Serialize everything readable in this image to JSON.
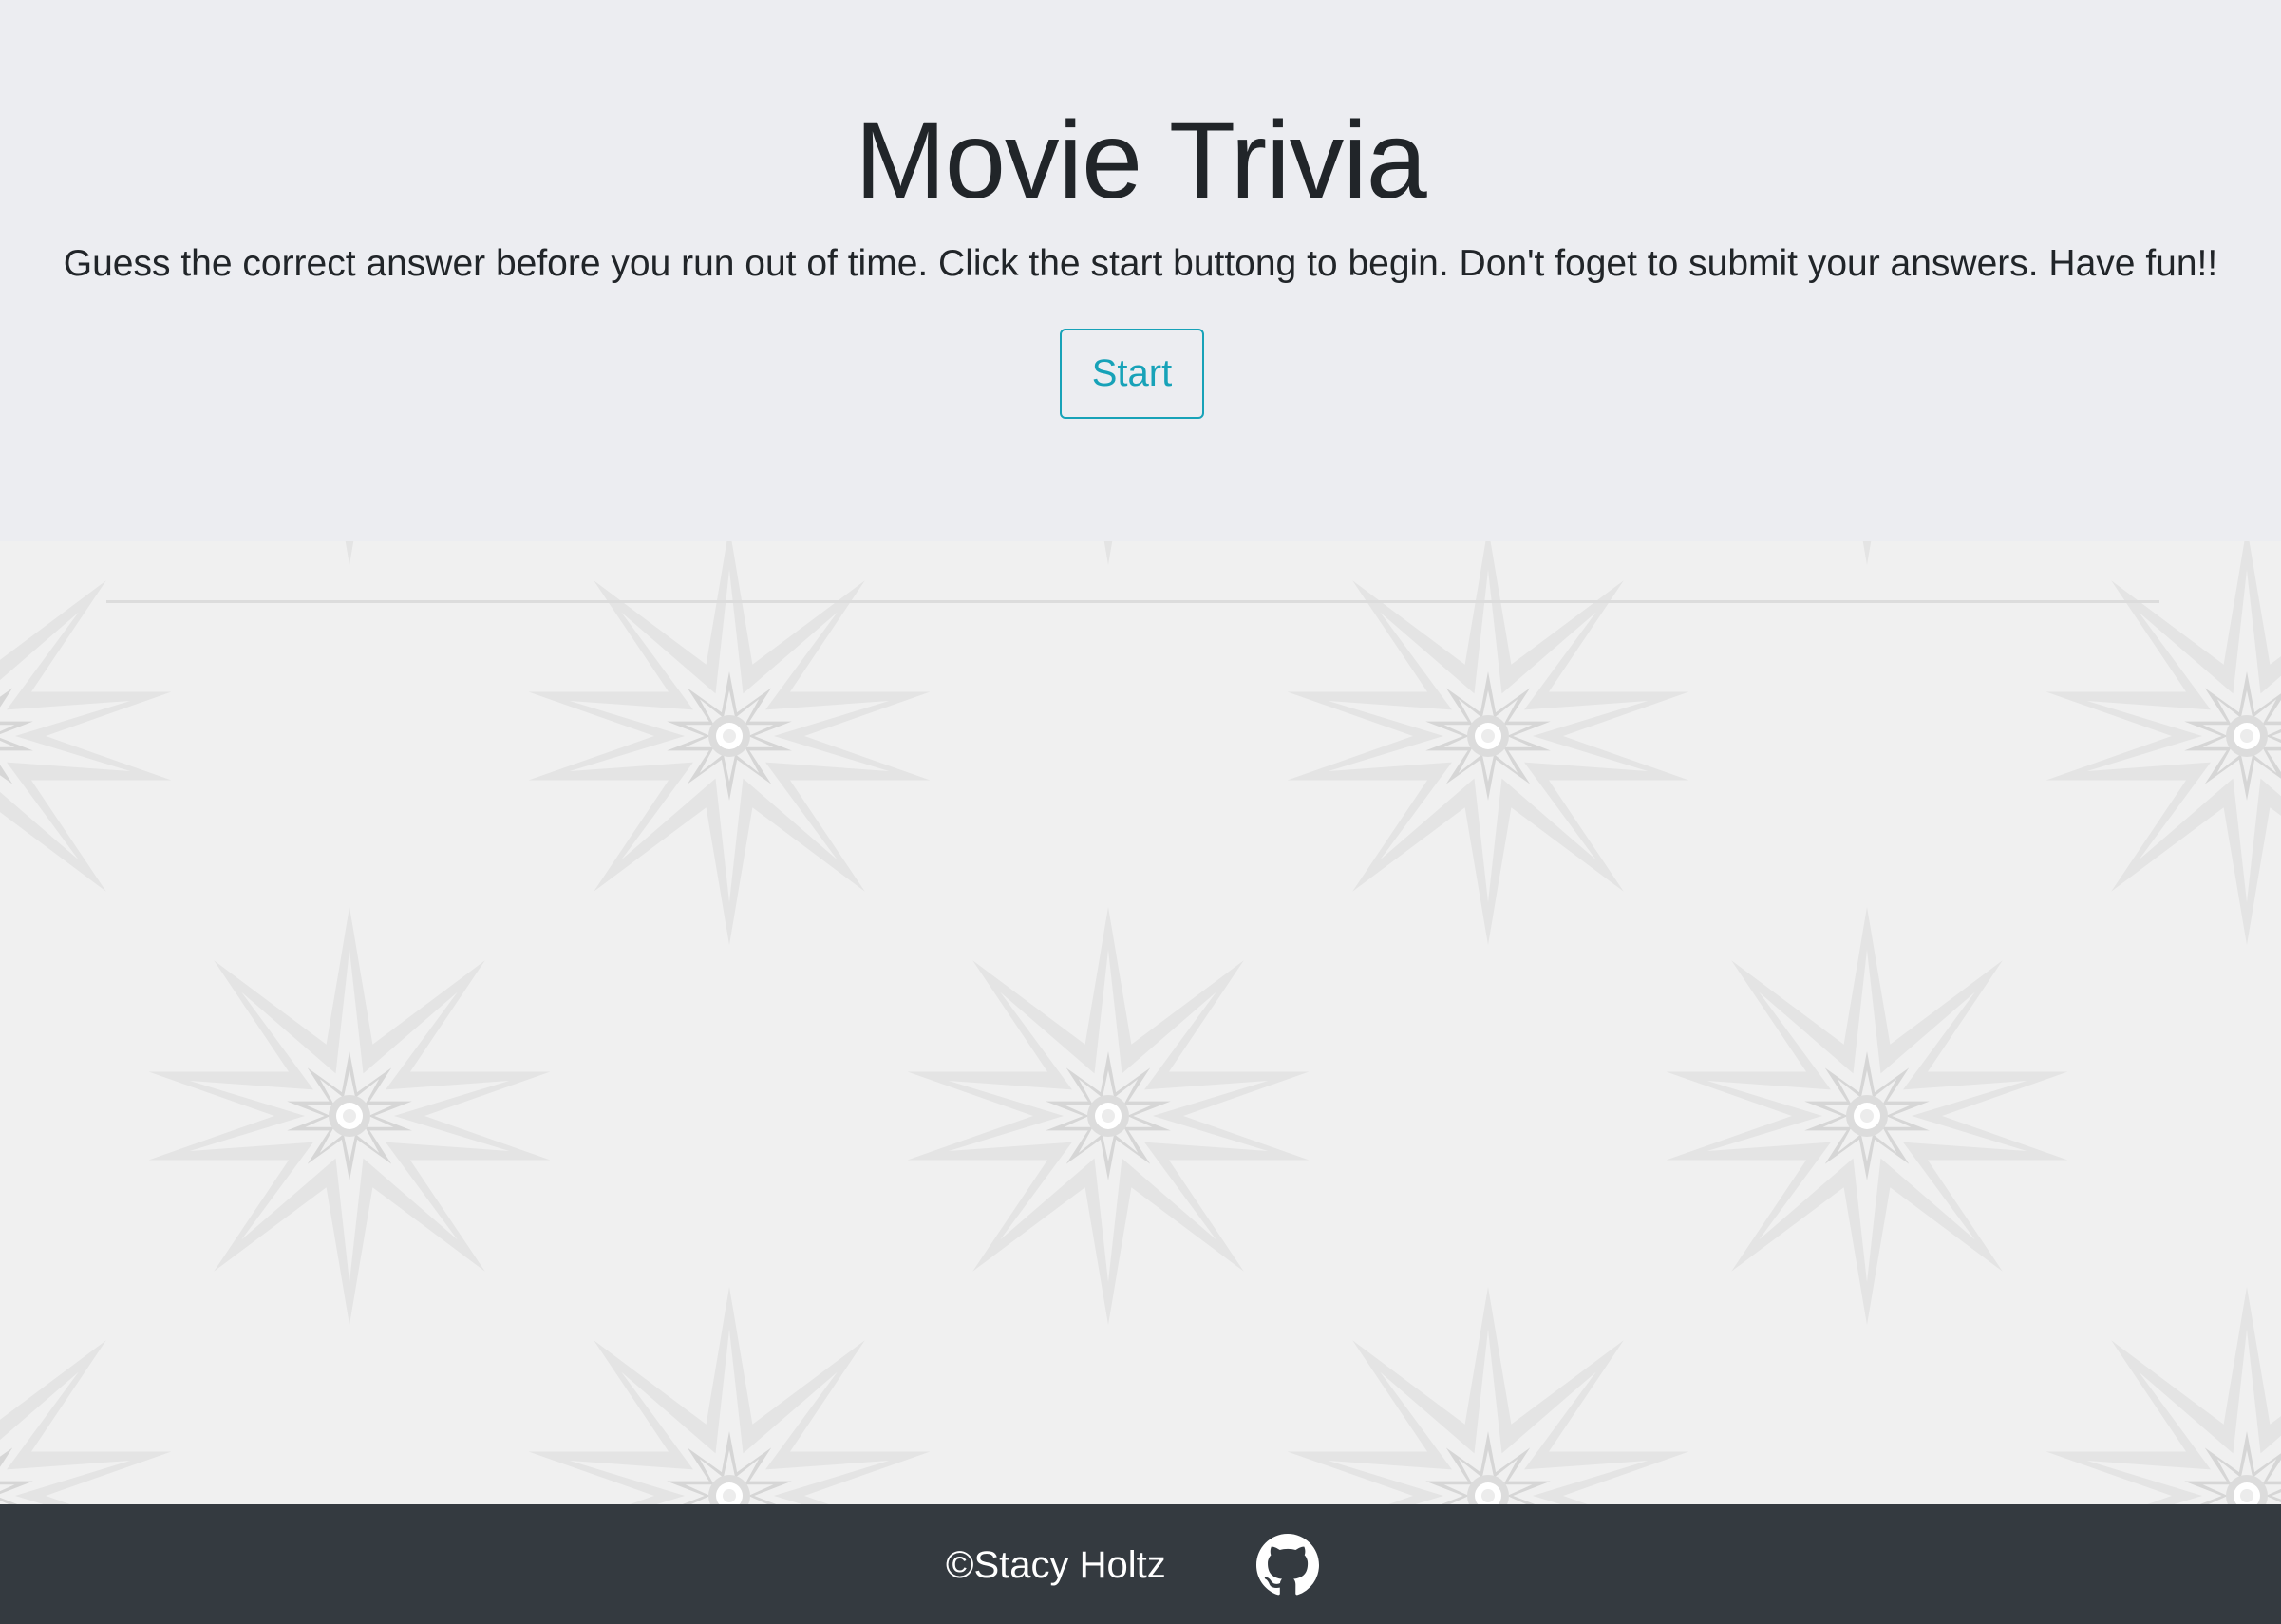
{
  "jumbotron": {
    "title": "Movie Trivia",
    "description": "Guess the correct answer before you run out of time. Click the start buttong to begin. Don't foget to submit your answers. Have fun!!",
    "start_label": "Start"
  },
  "footer": {
    "copyright": "©Stacy Holtz",
    "github_icon": "github-icon"
  },
  "colors": {
    "accent": "#17a2b8",
    "jumbotron_bg": "#ecedf1",
    "body_bg": "#f0f0f0",
    "footer_bg": "#343a40",
    "footer_text": "#ffffff"
  }
}
